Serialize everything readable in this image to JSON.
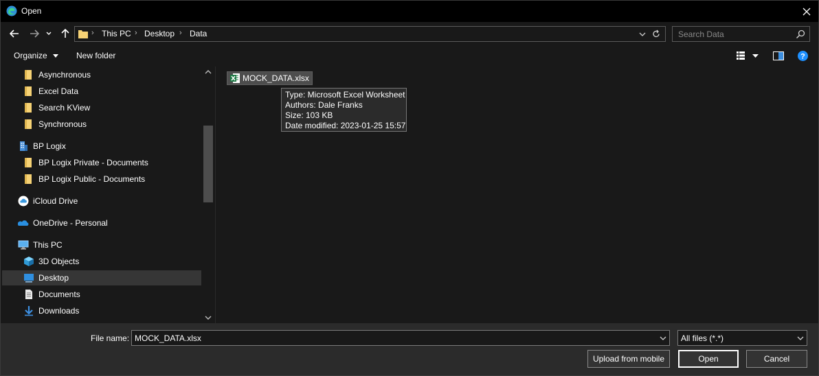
{
  "window": {
    "title": "Open"
  },
  "nav": {
    "back": "back-arrow",
    "forward": "forward-arrow",
    "recent": "chevron-down",
    "up": "up-arrow",
    "breadcrumbs": [
      "This PC",
      "Desktop",
      "Data"
    ],
    "search_placeholder": "Search Data"
  },
  "command_bar": {
    "organize_label": "Organize",
    "new_folder_label": "New folder"
  },
  "sidebar": {
    "items": [
      {
        "label": "Asynchronous",
        "icon": "folder-icon"
      },
      {
        "label": "Excel Data",
        "icon": "folder-icon"
      },
      {
        "label": "Search KView",
        "icon": "folder-icon"
      },
      {
        "label": "Synchronous",
        "icon": "folder-icon"
      },
      {
        "label": "BP Logix",
        "icon": "building-icon"
      },
      {
        "label": "BP Logix Private - Documents",
        "icon": "folder-icon"
      },
      {
        "label": "BP Logix Public - Documents",
        "icon": "folder-icon"
      },
      {
        "label": "iCloud Drive",
        "icon": "icloud-icon"
      },
      {
        "label": "OneDrive - Personal",
        "icon": "onedrive-icon"
      },
      {
        "label": "This PC",
        "icon": "computer-icon"
      },
      {
        "label": "3D Objects",
        "icon": "cube-icon"
      },
      {
        "label": "Desktop",
        "icon": "desktop-icon",
        "selected": true
      },
      {
        "label": "Documents",
        "icon": "document-icon"
      },
      {
        "label": "Downloads",
        "icon": "download-icon"
      }
    ]
  },
  "files": [
    {
      "name": "MOCK_DATA.xlsx",
      "icon": "excel-icon"
    }
  ],
  "tooltip": {
    "type": "Type: Microsoft Excel Worksheet",
    "authors": "Authors: Dale Franks",
    "size": "Size: 103 KB",
    "modified": "Date modified: 2023-01-25 15:57"
  },
  "footer": {
    "file_name_label": "File name:",
    "file_name_value": "MOCK_DATA.xlsx",
    "filter_value": "All files (*.*)",
    "upload_label": "Upload from mobile",
    "open_label": "Open",
    "cancel_label": "Cancel"
  },
  "colors": {
    "background": "#191919",
    "titlebar": "#000000",
    "footer": "#2b2b2b",
    "folder": "#f6d275",
    "accent_blue": "#1e90ff",
    "excel_green": "#1d7a45"
  }
}
